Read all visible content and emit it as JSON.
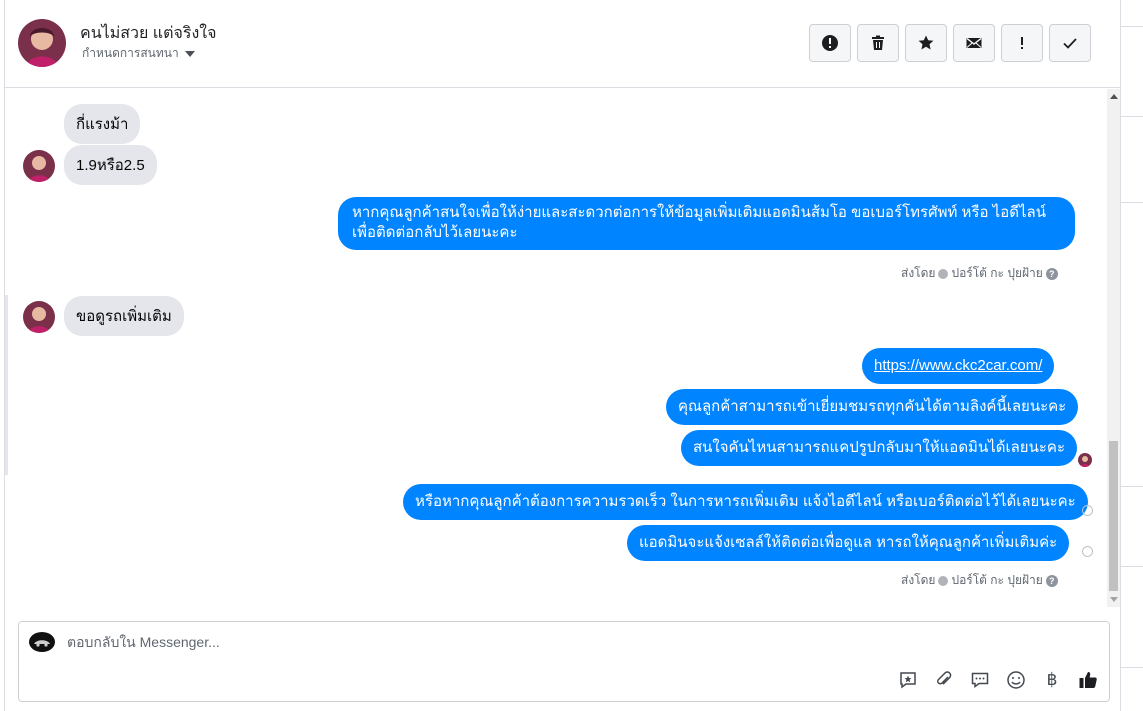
{
  "header": {
    "contact_name": "คนไม่สวย แต่จริงใจ",
    "assign_label": "กำหนดการสนทนา",
    "toolbar": [
      {
        "icon": "alert-circle-icon",
        "label": "mark-spam"
      },
      {
        "icon": "trash-icon",
        "label": "delete"
      },
      {
        "icon": "star-icon",
        "label": "star"
      },
      {
        "icon": "envelope-icon",
        "label": "mark-unread"
      },
      {
        "icon": "exclamation-icon",
        "label": "follow-up"
      },
      {
        "icon": "check-icon",
        "label": "done"
      }
    ]
  },
  "messages": {
    "in1": "กี่แรงม้า",
    "in2": "1.9หรือ2.5",
    "out1": "หากคุณลูกค้าสนใจเพื่อให้ง่ายและสะดวกต่อการให้ข้อมูลเพิ่มเติมแอดมินส้มโอ ขอเบอร์โทรศัพท์ หรือ ไอดีไลน์ เพื่อติดต่อกลับไว้เลยนะคะ",
    "in3": "ขอดูรถเพิ่มเติม",
    "out_link": "https://www.ckc2car.com/",
    "out2": "คุณลูกค้าสามารถเข้าเยี่ยมชมรถทุกคันได้ตามลิงค์นี้เลยนะคะ",
    "out3": "สนใจคันไหนสามารถแคปรูปกลับมาให้แอดมินได้เลยนะคะ",
    "out4": "หรือหากคุณลูกค้าต้องการความรวดเร็ว ในการหารถเพิ่มเติม แจ้งไอดีไลน์ หรือเบอร์ติดต่อไว้ได้เลยนะคะ",
    "out5": "แอดมินจะแจ้งเซลล์ให้ติดต่อเพื่อดูแล หารถให้คุณลูกค้าเพิ่มเติมค่ะ"
  },
  "sent_by": {
    "prefix": "ส่งโดย",
    "name": "ปอร์โต้ กะ ปุยฝ้าย"
  },
  "composer": {
    "placeholder": "ตอบกลับใน Messenger...",
    "tools": [
      "sticker-reply-icon",
      "paperclip-icon",
      "saved-replies-icon",
      "emoji-icon",
      "baht-icon",
      "thumbs-up-icon"
    ],
    "baht_symbol": "฿"
  },
  "colors": {
    "outgoing_bubble": "#0084ff",
    "incoming_bubble": "#e4e6eb"
  }
}
